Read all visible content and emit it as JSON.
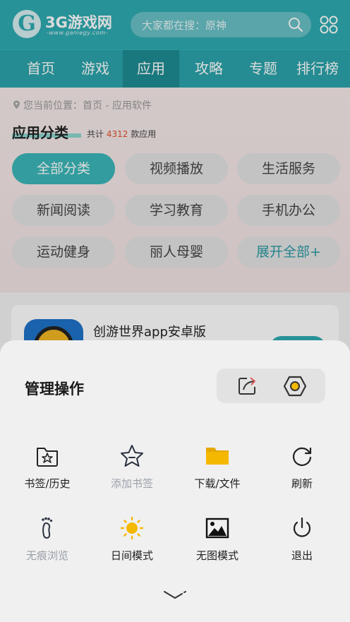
{
  "site": {
    "logo_mark": "G",
    "logo_text": "3G游戏网",
    "logo_url": "-www.gamegy.com-",
    "search_placeholder": "大家都在搜：原神"
  },
  "nav": {
    "items": [
      {
        "label": "首页",
        "active": false
      },
      {
        "label": "游戏",
        "active": false
      },
      {
        "label": "应用",
        "active": true
      },
      {
        "label": "攻略",
        "active": false
      },
      {
        "label": "专题",
        "active": false
      },
      {
        "label": "排行榜",
        "active": false
      }
    ]
  },
  "breadcrumb": "您当前位置：首页 - 应用软件",
  "section": {
    "title": "应用分类",
    "count_prefix": "共计",
    "count": "4312",
    "count_suffix": "款应用"
  },
  "categories": [
    {
      "label": "全部分类",
      "active": true
    },
    {
      "label": "视频播放",
      "active": false
    },
    {
      "label": "生活服务",
      "active": false
    },
    {
      "label": "新闻阅读",
      "active": false
    },
    {
      "label": "学习教育",
      "active": false
    },
    {
      "label": "手机办公",
      "active": false
    },
    {
      "label": "运动健身",
      "active": false
    },
    {
      "label": "丽人母婴",
      "active": false
    },
    {
      "label": "展开全部+",
      "active": false
    }
  ],
  "app_card": {
    "name": "创游世界app安卓版"
  },
  "sheet": {
    "title": "管理操作",
    "top_actions": [
      {
        "icon": "share-icon"
      },
      {
        "icon": "settings-icon"
      }
    ],
    "menu": [
      {
        "label": "书签/历史",
        "icon": "bookmark-folder-icon",
        "dim": false
      },
      {
        "label": "添加书签",
        "icon": "star-icon",
        "dim": true
      },
      {
        "label": "下载/文件",
        "icon": "folder-icon",
        "dim": false
      },
      {
        "label": "刷新",
        "icon": "refresh-icon",
        "dim": false
      },
      {
        "label": "无痕浏览",
        "icon": "footprint-icon",
        "dim": true
      },
      {
        "label": "日间模式",
        "icon": "sun-icon",
        "dim": false
      },
      {
        "label": "无图模式",
        "icon": "image-icon",
        "dim": false
      },
      {
        "label": "退出",
        "icon": "power-icon",
        "dim": false
      }
    ]
  },
  "colors": {
    "brand": "#2eaab0",
    "nav_active": "#1e8c92",
    "count_highlight": "#e0522b",
    "folder": "#f5b800",
    "sun": "#f5b800"
  }
}
